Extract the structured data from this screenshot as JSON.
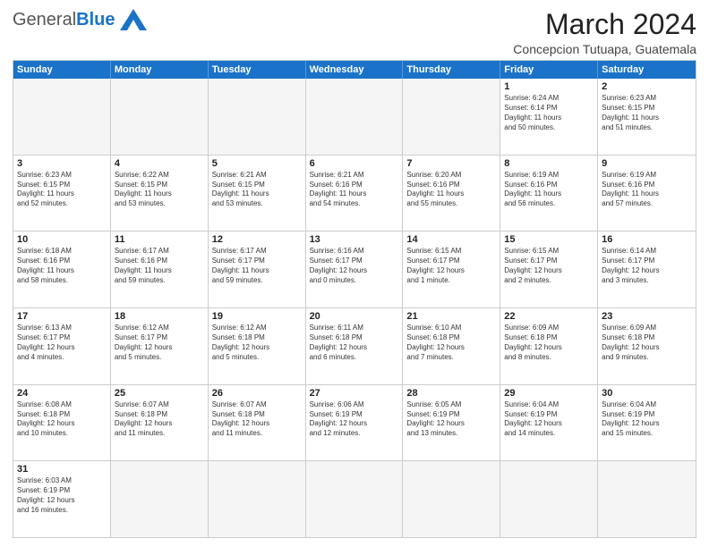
{
  "header": {
    "logo_general": "General",
    "logo_blue": "Blue",
    "month_year": "March 2024",
    "location": "Concepcion Tutuapa, Guatemala"
  },
  "weekdays": [
    "Sunday",
    "Monday",
    "Tuesday",
    "Wednesday",
    "Thursday",
    "Friday",
    "Saturday"
  ],
  "rows": [
    [
      {
        "day": "",
        "empty": true,
        "info": ""
      },
      {
        "day": "",
        "empty": true,
        "info": ""
      },
      {
        "day": "",
        "empty": true,
        "info": ""
      },
      {
        "day": "",
        "empty": true,
        "info": ""
      },
      {
        "day": "",
        "empty": true,
        "info": ""
      },
      {
        "day": "1",
        "empty": false,
        "info": "Sunrise: 6:24 AM\nSunset: 6:14 PM\nDaylight: 11 hours\nand 50 minutes."
      },
      {
        "day": "2",
        "empty": false,
        "info": "Sunrise: 6:23 AM\nSunset: 6:15 PM\nDaylight: 11 hours\nand 51 minutes."
      }
    ],
    [
      {
        "day": "3",
        "empty": false,
        "info": "Sunrise: 6:23 AM\nSunset: 6:15 PM\nDaylight: 11 hours\nand 52 minutes."
      },
      {
        "day": "4",
        "empty": false,
        "info": "Sunrise: 6:22 AM\nSunset: 6:15 PM\nDaylight: 11 hours\nand 53 minutes."
      },
      {
        "day": "5",
        "empty": false,
        "info": "Sunrise: 6:21 AM\nSunset: 6:15 PM\nDaylight: 11 hours\nand 53 minutes."
      },
      {
        "day": "6",
        "empty": false,
        "info": "Sunrise: 6:21 AM\nSunset: 6:16 PM\nDaylight: 11 hours\nand 54 minutes."
      },
      {
        "day": "7",
        "empty": false,
        "info": "Sunrise: 6:20 AM\nSunset: 6:16 PM\nDaylight: 11 hours\nand 55 minutes."
      },
      {
        "day": "8",
        "empty": false,
        "info": "Sunrise: 6:19 AM\nSunset: 6:16 PM\nDaylight: 11 hours\nand 56 minutes."
      },
      {
        "day": "9",
        "empty": false,
        "info": "Sunrise: 6:19 AM\nSunset: 6:16 PM\nDaylight: 11 hours\nand 57 minutes."
      }
    ],
    [
      {
        "day": "10",
        "empty": false,
        "info": "Sunrise: 6:18 AM\nSunset: 6:16 PM\nDaylight: 11 hours\nand 58 minutes."
      },
      {
        "day": "11",
        "empty": false,
        "info": "Sunrise: 6:17 AM\nSunset: 6:16 PM\nDaylight: 11 hours\nand 59 minutes."
      },
      {
        "day": "12",
        "empty": false,
        "info": "Sunrise: 6:17 AM\nSunset: 6:17 PM\nDaylight: 11 hours\nand 59 minutes."
      },
      {
        "day": "13",
        "empty": false,
        "info": "Sunrise: 6:16 AM\nSunset: 6:17 PM\nDaylight: 12 hours\nand 0 minutes."
      },
      {
        "day": "14",
        "empty": false,
        "info": "Sunrise: 6:15 AM\nSunset: 6:17 PM\nDaylight: 12 hours\nand 1 minute."
      },
      {
        "day": "15",
        "empty": false,
        "info": "Sunrise: 6:15 AM\nSunset: 6:17 PM\nDaylight: 12 hours\nand 2 minutes."
      },
      {
        "day": "16",
        "empty": false,
        "info": "Sunrise: 6:14 AM\nSunset: 6:17 PM\nDaylight: 12 hours\nand 3 minutes."
      }
    ],
    [
      {
        "day": "17",
        "empty": false,
        "info": "Sunrise: 6:13 AM\nSunset: 6:17 PM\nDaylight: 12 hours\nand 4 minutes."
      },
      {
        "day": "18",
        "empty": false,
        "info": "Sunrise: 6:12 AM\nSunset: 6:17 PM\nDaylight: 12 hours\nand 5 minutes."
      },
      {
        "day": "19",
        "empty": false,
        "info": "Sunrise: 6:12 AM\nSunset: 6:18 PM\nDaylight: 12 hours\nand 5 minutes."
      },
      {
        "day": "20",
        "empty": false,
        "info": "Sunrise: 6:11 AM\nSunset: 6:18 PM\nDaylight: 12 hours\nand 6 minutes."
      },
      {
        "day": "21",
        "empty": false,
        "info": "Sunrise: 6:10 AM\nSunset: 6:18 PM\nDaylight: 12 hours\nand 7 minutes."
      },
      {
        "day": "22",
        "empty": false,
        "info": "Sunrise: 6:09 AM\nSunset: 6:18 PM\nDaylight: 12 hours\nand 8 minutes."
      },
      {
        "day": "23",
        "empty": false,
        "info": "Sunrise: 6:09 AM\nSunset: 6:18 PM\nDaylight: 12 hours\nand 9 minutes."
      }
    ],
    [
      {
        "day": "24",
        "empty": false,
        "info": "Sunrise: 6:08 AM\nSunset: 6:18 PM\nDaylight: 12 hours\nand 10 minutes."
      },
      {
        "day": "25",
        "empty": false,
        "info": "Sunrise: 6:07 AM\nSunset: 6:18 PM\nDaylight: 12 hours\nand 11 minutes."
      },
      {
        "day": "26",
        "empty": false,
        "info": "Sunrise: 6:07 AM\nSunset: 6:18 PM\nDaylight: 12 hours\nand 11 minutes."
      },
      {
        "day": "27",
        "empty": false,
        "info": "Sunrise: 6:06 AM\nSunset: 6:19 PM\nDaylight: 12 hours\nand 12 minutes."
      },
      {
        "day": "28",
        "empty": false,
        "info": "Sunrise: 6:05 AM\nSunset: 6:19 PM\nDaylight: 12 hours\nand 13 minutes."
      },
      {
        "day": "29",
        "empty": false,
        "info": "Sunrise: 6:04 AM\nSunset: 6:19 PM\nDaylight: 12 hours\nand 14 minutes."
      },
      {
        "day": "30",
        "empty": false,
        "info": "Sunrise: 6:04 AM\nSunset: 6:19 PM\nDaylight: 12 hours\nand 15 minutes."
      }
    ],
    [
      {
        "day": "31",
        "empty": false,
        "info": "Sunrise: 6:03 AM\nSunset: 6:19 PM\nDaylight: 12 hours\nand 16 minutes."
      },
      {
        "day": "",
        "empty": true,
        "info": ""
      },
      {
        "day": "",
        "empty": true,
        "info": ""
      },
      {
        "day": "",
        "empty": true,
        "info": ""
      },
      {
        "day": "",
        "empty": true,
        "info": ""
      },
      {
        "day": "",
        "empty": true,
        "info": ""
      },
      {
        "day": "",
        "empty": true,
        "info": ""
      }
    ]
  ]
}
